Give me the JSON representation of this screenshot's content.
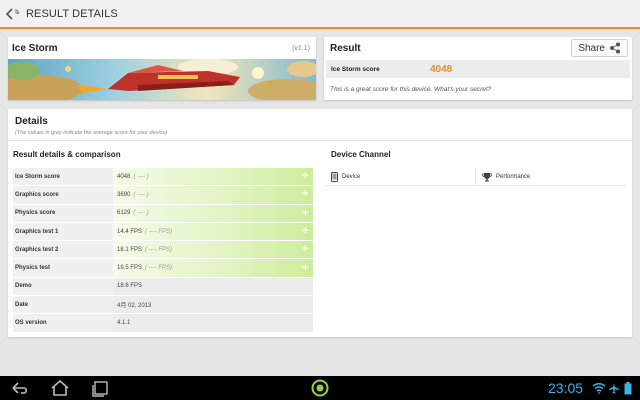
{
  "header": {
    "title": "RESULT DETAILS",
    "back_icon": "back-arrow-icon",
    "accent_color": "#f08a2c"
  },
  "test": {
    "name": "Ice Storm",
    "version": "(v1.1)"
  },
  "result": {
    "title": "Result",
    "share_label": "Share",
    "score_label": "Ice Storm score",
    "score_value": "4048",
    "message": "This is a great score for this device. What's your secret?"
  },
  "details": {
    "title": "Details",
    "subtitle": "(The values in grey indicate the average score for your device)",
    "left_heading": "Result details & comparison",
    "right_heading": "Device Channel",
    "rows": [
      {
        "label": "Ice Storm score",
        "value": "4048",
        "avg": "( ---- )",
        "green": true
      },
      {
        "label": "Graphics score",
        "value": "3690",
        "avg": "( ---- )",
        "green": true
      },
      {
        "label": "Physics score",
        "value": "6129",
        "avg": "( ---- )",
        "green": true
      },
      {
        "label": "Graphics test 1",
        "value": "14.4 FPS",
        "avg": "( ---- FPS)",
        "green": true
      },
      {
        "label": "Graphics test 2",
        "value": "18.1 FPS",
        "avg": "( ---- FPS)",
        "green": true
      },
      {
        "label": "Physics test",
        "value": "19.5 FPS",
        "avg": "( ---- FPS)",
        "green": true
      },
      {
        "label": "Demo",
        "value": "18.6 FPS",
        "avg": "",
        "green": false
      },
      {
        "label": "Date",
        "value": "4月 02, 2013",
        "avg": "",
        "green": false
      },
      {
        "label": "OS version",
        "value": "4.1.1",
        "avg": "",
        "green": false
      }
    ],
    "channel": {
      "device_label": "Device",
      "performance_label": "Performance"
    }
  },
  "system_bar": {
    "time": "23:05",
    "clock_color": "#39b5e7"
  }
}
